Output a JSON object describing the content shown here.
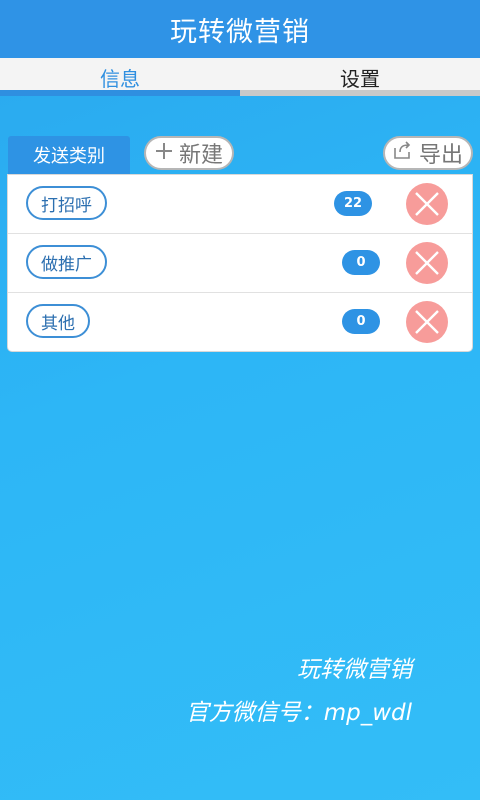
{
  "app": {
    "title": "玩转微营销"
  },
  "tabs": [
    {
      "label": "信息",
      "active": true
    },
    {
      "label": "设置",
      "active": false
    }
  ],
  "toolbar": {
    "category_label": "发送类别",
    "new_label": "新建",
    "export_label": "导出"
  },
  "categories": [
    {
      "name": "打招呼",
      "count": "22"
    },
    {
      "name": "做推广",
      "count": "0"
    },
    {
      "name": "其他",
      "count": "0"
    }
  ],
  "footer": {
    "line1": "玩转微营销",
    "line2": "官方微信号：mp_wdl"
  },
  "colors": {
    "accent": "#2f93e6",
    "background": "#2db6f6",
    "delete": "#f79c9a"
  }
}
